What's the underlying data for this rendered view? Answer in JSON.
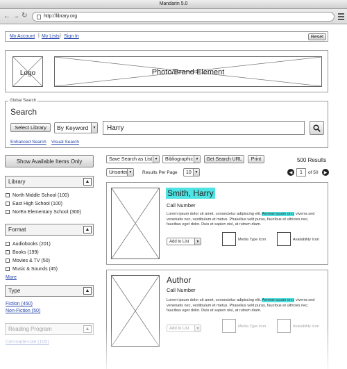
{
  "window": {
    "title": "Mandarin 5.0"
  },
  "browser": {
    "url": "http://library.org"
  },
  "topnav": {
    "my_account": "My Account",
    "my_lists": "My Lists",
    "sign_in": "Sign In",
    "reset": "Reset"
  },
  "header": {
    "logo": "Logo",
    "brand": "Photo/Brand Element"
  },
  "search": {
    "group_label": "Global Search",
    "title": "Search",
    "select_library": "Select Library",
    "by_keyword": "By Keyword",
    "query": "Harry",
    "enhanced": "Enhanced Search",
    "visual": "Visual Search"
  },
  "sidebar": {
    "show_available": "Show Available Items Only",
    "library": {
      "title": "Library",
      "items": [
        "North Middle School (100)",
        "East High School (100)",
        "NorEa Elementary School (300)"
      ]
    },
    "format": {
      "title": "Format",
      "items": [
        "Audiobooks (201)",
        "Books (199)",
        "Movies & TV (50)",
        "Music & Sounds (45)"
      ],
      "more": "More"
    },
    "type": {
      "title": "Type",
      "items": [
        "Fiction (450)",
        "Non-Fiction (50)"
      ]
    },
    "reading_program": {
      "title": "Reading Program",
      "items": [
        "Cel-matte-rule (100)"
      ]
    }
  },
  "toolbar": {
    "save_search": "Save Search as List",
    "bibliographic": "Bibliographic",
    "get_search_url": "Get Search URL",
    "print": "Print",
    "result_count": "500 Results",
    "unsorted": "Unsorted",
    "results_per_page_label": "Results Per Page",
    "results_per_page": "10",
    "page": "1",
    "of_pages": "of 50"
  },
  "results": [
    {
      "title": "Smith, Harry",
      "call_number": "Call Number",
      "desc_pre": "Lorem ipsum dolor sit amet, consectetur adipiscing elit. ",
      "desc_hl": "Aenean quam orci,",
      "desc_post": " viverra sed venenatis nec, vestibulum et metus. Phasellus velit purus, faucibus et ultricies nec, faucibus eget dolor. Duis et sapien nisl, at rutrum diam.",
      "add_to_list": "Add to List",
      "media_type_icon": "Media Type Icon",
      "availability_icon": "Availability Icon"
    },
    {
      "title": "Author",
      "call_number": "Call Number",
      "desc_pre": "Lorem ipsum dolor sit amet, consectetur adipiscing elit. ",
      "desc_hl": "Aenean quam orci,",
      "desc_post": " viverra sed venenatis nec, vestibulum et metus. Phasellus velit purus, faucibus et ultricies nec, faucibus eget dolor. Duis et sapien nisl, at rutrum diam.",
      "add_to_list": "Add to List",
      "media_type_icon": "Media Type Icon",
      "availability_icon": "Availability Icon"
    }
  ]
}
